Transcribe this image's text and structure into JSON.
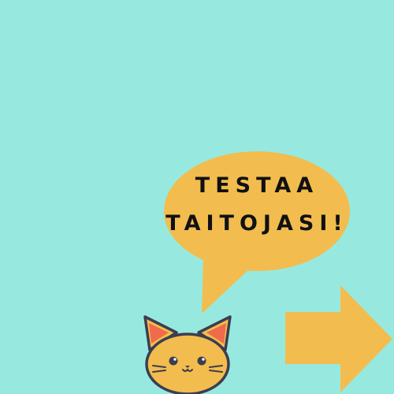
{
  "graphic": {
    "background_color": "#97e9e0",
    "accent_color": "#f2bd4e",
    "speech_bubble": {
      "line1": "TESTAA",
      "line2": "TAITOJASI!"
    },
    "icons": [
      "speech-bubble-icon",
      "cat-face-icon",
      "arrow-right-icon"
    ]
  }
}
